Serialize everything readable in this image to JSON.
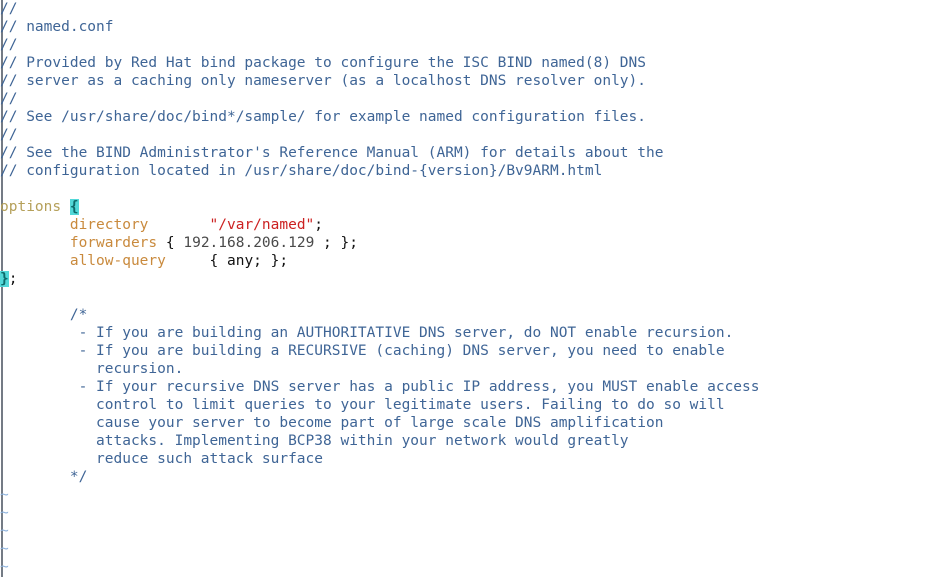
{
  "editor": {
    "name": "vim-text-editor",
    "filename": "named.conf",
    "background_color": "#ffffff",
    "colors": {
      "comment": "#3f6596",
      "keyword": "#c98a3d",
      "block_keyword": "#b5a05a",
      "string": "#cc2222",
      "number": "#4a4a4a",
      "punctuation": "#111111",
      "tilde": "#8fb3dd",
      "match_brace_bg": "#52d8d8",
      "match_brace_fg": "#0d6a6a"
    }
  },
  "lines": [
    {
      "n": 1,
      "indent": 0,
      "segments": [
        {
          "t": "cmt",
          "v": "//"
        }
      ]
    },
    {
      "n": 2,
      "indent": 0,
      "segments": [
        {
          "t": "cmt",
          "v": "// named.conf"
        }
      ]
    },
    {
      "n": 3,
      "indent": 0,
      "segments": [
        {
          "t": "cmt",
          "v": "//"
        }
      ]
    },
    {
      "n": 4,
      "indent": 0,
      "segments": [
        {
          "t": "cmt",
          "v": "// Provided by Red Hat bind package to configure the ISC BIND named(8) DNS"
        }
      ]
    },
    {
      "n": 5,
      "indent": 0,
      "segments": [
        {
          "t": "cmt",
          "v": "// server as a caching only nameserver (as a localhost DNS resolver only)."
        }
      ]
    },
    {
      "n": 6,
      "indent": 0,
      "segments": [
        {
          "t": "cmt",
          "v": "//"
        }
      ]
    },
    {
      "n": 7,
      "indent": 0,
      "segments": [
        {
          "t": "cmt",
          "v": "// See /usr/share/doc/bind*/sample/ for example named configuration files."
        }
      ]
    },
    {
      "n": 8,
      "indent": 0,
      "segments": [
        {
          "t": "cmt",
          "v": "//"
        }
      ]
    },
    {
      "n": 9,
      "indent": 0,
      "segments": [
        {
          "t": "cmt",
          "v": "// See the BIND Administrator's Reference Manual (ARM) for details about the"
        }
      ]
    },
    {
      "n": 10,
      "indent": 0,
      "segments": [
        {
          "t": "cmt",
          "v": "// configuration located in /usr/share/doc/bind-{version}/Bv9ARM.html"
        }
      ]
    },
    {
      "n": 11,
      "indent": 0,
      "segments": []
    },
    {
      "n": 12,
      "indent": 0,
      "segments": [
        {
          "t": "blockkw",
          "v": "options "
        },
        {
          "t": "matchbrace",
          "v": "{"
        }
      ]
    },
    {
      "n": 13,
      "indent": 0,
      "segments": [
        {
          "t": "txt",
          "v": "        "
        },
        {
          "t": "kw",
          "v": "directory"
        },
        {
          "t": "txt",
          "v": "       "
        },
        {
          "t": "str",
          "v": "\"/var/named\""
        },
        {
          "t": "punct",
          "v": ";"
        }
      ]
    },
    {
      "n": 14,
      "indent": 0,
      "segments": [
        {
          "t": "txt",
          "v": "        "
        },
        {
          "t": "kw",
          "v": "forwarders"
        },
        {
          "t": "punct",
          "v": " { "
        },
        {
          "t": "num",
          "v": "192.168.206.129"
        },
        {
          "t": "punct",
          "v": " ; };"
        }
      ]
    },
    {
      "n": 15,
      "indent": 0,
      "segments": [
        {
          "t": "txt",
          "v": "        "
        },
        {
          "t": "kw",
          "v": "allow-query"
        },
        {
          "t": "punct",
          "v": "     { any; };"
        }
      ]
    },
    {
      "n": 16,
      "indent": 0,
      "segments": [
        {
          "t": "matchbrace",
          "v": "}"
        },
        {
          "t": "punct",
          "v": ";"
        }
      ]
    },
    {
      "n": 17,
      "indent": 0,
      "segments": []
    },
    {
      "n": 18,
      "indent": 0,
      "segments": [
        {
          "t": "cmt",
          "v": "        /*"
        }
      ]
    },
    {
      "n": 19,
      "indent": 0,
      "segments": [
        {
          "t": "cmt",
          "v": "         - If you are building an AUTHORITATIVE DNS server, do NOT enable recursion."
        }
      ]
    },
    {
      "n": 20,
      "indent": 0,
      "segments": [
        {
          "t": "cmt",
          "v": "         - If you are building a RECURSIVE (caching) DNS server, you need to enable"
        }
      ]
    },
    {
      "n": 21,
      "indent": 0,
      "segments": [
        {
          "t": "cmt",
          "v": "           recursion."
        }
      ]
    },
    {
      "n": 22,
      "indent": 0,
      "segments": [
        {
          "t": "cmt",
          "v": "         - If your recursive DNS server has a public IP address, you MUST enable access"
        }
      ]
    },
    {
      "n": 23,
      "indent": 0,
      "segments": [
        {
          "t": "cmt",
          "v": "           control to limit queries to your legitimate users. Failing to do so will"
        }
      ]
    },
    {
      "n": 24,
      "indent": 0,
      "segments": [
        {
          "t": "cmt",
          "v": "           cause your server to become part of large scale DNS amplification"
        }
      ]
    },
    {
      "n": 25,
      "indent": 0,
      "segments": [
        {
          "t": "cmt",
          "v": "           attacks. Implementing BCP38 within your network would greatly"
        }
      ]
    },
    {
      "n": 26,
      "indent": 0,
      "segments": [
        {
          "t": "cmt",
          "v": "           reduce such attack surface"
        }
      ]
    },
    {
      "n": 27,
      "indent": 0,
      "segments": [
        {
          "t": "cmt",
          "v": "        */"
        }
      ]
    },
    {
      "n": 28,
      "indent": 0,
      "segments": [
        {
          "t": "tilde",
          "v": "~"
        }
      ]
    },
    {
      "n": 29,
      "indent": 0,
      "segments": [
        {
          "t": "tilde",
          "v": "~"
        }
      ]
    },
    {
      "n": 30,
      "indent": 0,
      "segments": [
        {
          "t": "tilde",
          "v": "~"
        }
      ]
    },
    {
      "n": 31,
      "indent": 0,
      "segments": [
        {
          "t": "tilde",
          "v": "~"
        }
      ]
    },
    {
      "n": 32,
      "indent": 0,
      "segments": [
        {
          "t": "tilde",
          "v": "~"
        }
      ]
    }
  ]
}
